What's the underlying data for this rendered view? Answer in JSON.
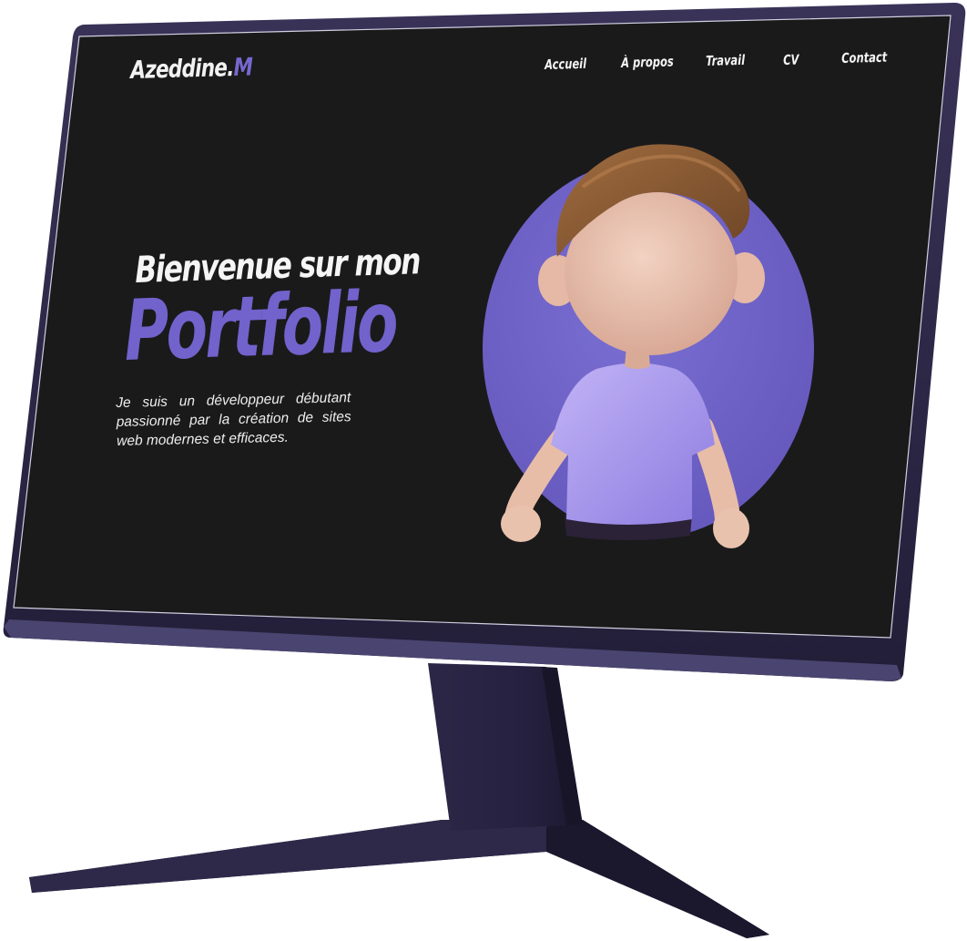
{
  "site": {
    "logo": {
      "name": "Azeddine.",
      "accent": "M"
    },
    "nav": [
      "Accueil",
      "À propos",
      "Travail",
      "CV",
      "Contact"
    ]
  },
  "hero": {
    "greeting": "Bienvenue sur mon",
    "title": "Portfolio",
    "description": "Je suis un développeur débutant passionné par la création de sites web modernes et efficaces."
  },
  "colors": {
    "accent": "#7262cc",
    "screen_bg": "#1a1a1b",
    "monitor_body": "#2d2848",
    "avatar_circle": "#6f63c6",
    "avatar_shirt": "#a796ea",
    "avatar_skin": "#ecc4b0",
    "avatar_hair": "#8a5a33"
  },
  "illustration": "3d-avatar-icon"
}
